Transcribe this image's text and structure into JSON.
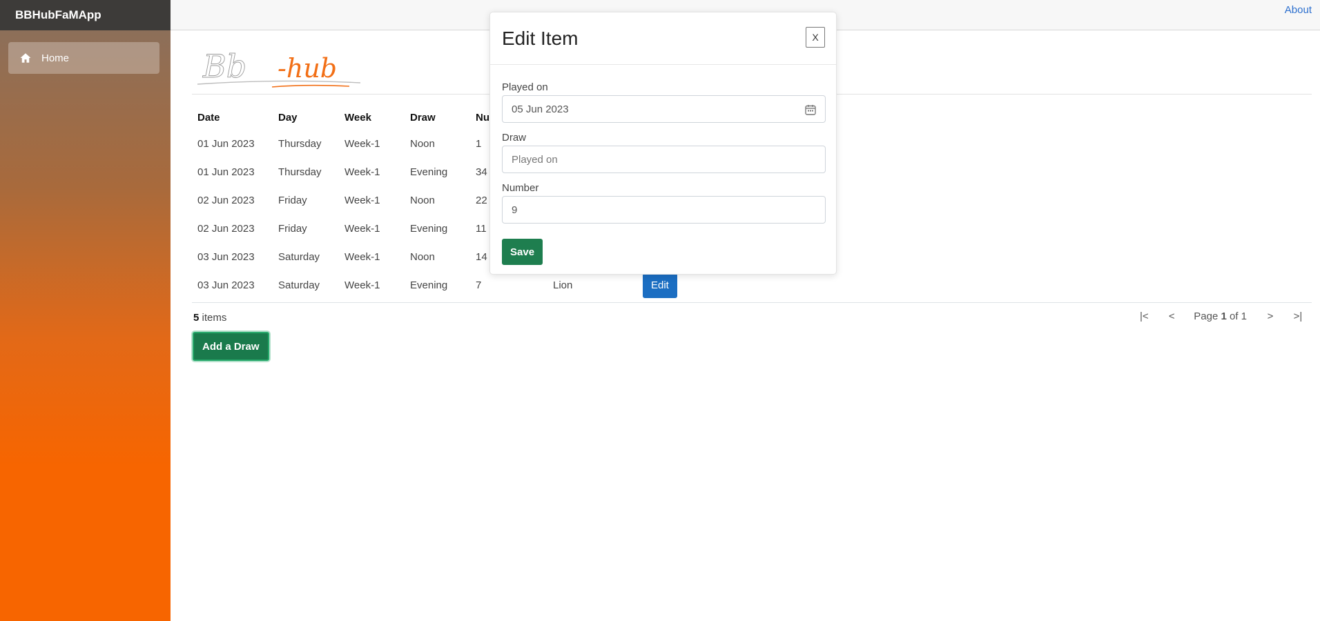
{
  "app": {
    "title": "BBHubFaMApp"
  },
  "sidebar": {
    "items": [
      {
        "label": "Home",
        "icon": "home-icon"
      }
    ]
  },
  "topbar": {
    "about_label": "About"
  },
  "logo": {
    "text_part1": "Bb",
    "text_part2": "-hub",
    "accent": "#f26f16"
  },
  "table": {
    "columns": [
      "Date",
      "Day",
      "Week",
      "Draw",
      "Nu"
    ],
    "rows": [
      {
        "date": "01 Jun 2023",
        "day": "Thursday",
        "week": "Week-1",
        "draw": "Noon",
        "number": "1"
      },
      {
        "date": "01 Jun 2023",
        "day": "Thursday",
        "week": "Week-1",
        "draw": "Evening",
        "number": "34"
      },
      {
        "date": "02 Jun 2023",
        "day": "Friday",
        "week": "Week-1",
        "draw": "Noon",
        "number": "22"
      },
      {
        "date": "02 Jun 2023",
        "day": "Friday",
        "week": "Week-1",
        "draw": "Evening",
        "number": "11"
      },
      {
        "date": "03 Jun 2023",
        "day": "Saturday",
        "week": "Week-1",
        "draw": "Noon",
        "number": "14"
      },
      {
        "date": "03 Jun 2023",
        "day": "Saturday",
        "week": "Week-1",
        "draw": "Evening",
        "number": "7",
        "animal": "Lion",
        "action": "Edit"
      }
    ]
  },
  "footer": {
    "count": "5",
    "count_suffix": " items",
    "pager": {
      "first": "|<",
      "prev": "<",
      "page_prefix": "Page ",
      "page": "1",
      "page_suffix": " of 1",
      "next": ">",
      "last": ">|"
    }
  },
  "add_button": "Add a Draw",
  "modal": {
    "title": "Edit Item",
    "close_label": "X",
    "fields": {
      "played_on_label": "Played on",
      "played_on_value": "05 Jun 2023",
      "draw_label": "Draw",
      "draw_placeholder": "Played on",
      "number_label": "Number",
      "number_value": "9"
    },
    "save_label": "Save"
  },
  "colors": {
    "sidebar_top": "#3d3b39",
    "sidebar_gradient_end": "#f76500",
    "edit_button": "#1b6ec2",
    "save_button": "#1e7e4f",
    "link": "#2c6fce"
  }
}
